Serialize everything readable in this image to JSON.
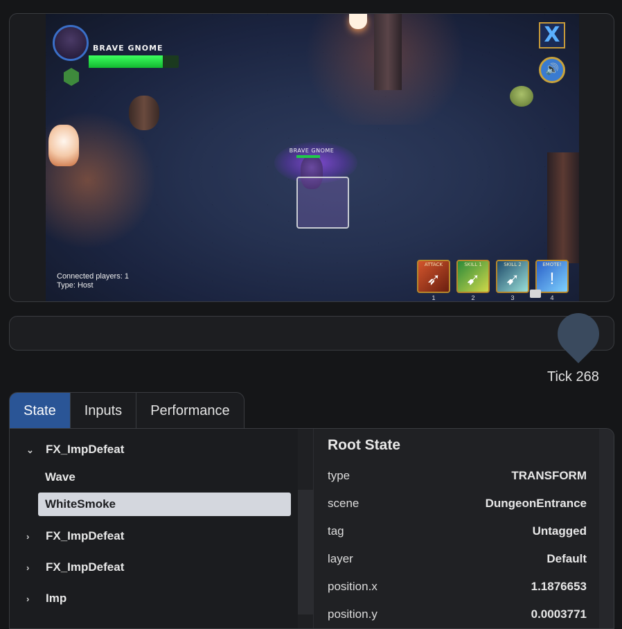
{
  "game": {
    "hud": {
      "player_name": "BRAVE GNOME",
      "health_fraction": 0.82,
      "overhead_name": "BRAVE GNOME"
    },
    "connection": {
      "players_line": "Connected players: 1",
      "type_line": "Type: Host"
    },
    "close_glyph": "X",
    "sound_glyph": "🔊",
    "abilities": [
      {
        "label": "ATTACK",
        "key": "1",
        "glyph": "➶",
        "icon": "bow-icon"
      },
      {
        "label": "SKILL 1",
        "key": "2",
        "glyph": "➹",
        "icon": "skill-arrow-icon"
      },
      {
        "label": "SKILL 2",
        "key": "3",
        "glyph": "➹",
        "icon": "multi-arrow-icon"
      },
      {
        "label": "EMOTE!",
        "key": "4",
        "glyph": "!",
        "icon": "emote-icon"
      }
    ]
  },
  "timeline": {
    "tick_label": "Tick 268"
  },
  "tabs": [
    {
      "label": "State",
      "active": true
    },
    {
      "label": "Inputs",
      "active": false
    },
    {
      "label": "Performance",
      "active": false
    }
  ],
  "tree": {
    "items": [
      {
        "label": "FX_ImpDefeat",
        "chevron": "⌄",
        "expanded": true
      },
      {
        "label": "Wave"
      },
      {
        "label": "WhiteSmoke",
        "selected": true
      },
      {
        "label": "FX_ImpDefeat",
        "chevron": "›"
      },
      {
        "label": "FX_ImpDefeat",
        "chevron": "›"
      },
      {
        "label": "Imp",
        "chevron": "›"
      }
    ]
  },
  "state": {
    "title": "Root State",
    "properties": [
      {
        "key": "type",
        "value": "TRANSFORM"
      },
      {
        "key": "scene",
        "value": "DungeonEntrance"
      },
      {
        "key": "tag",
        "value": "Untagged"
      },
      {
        "key": "layer",
        "value": "Default"
      },
      {
        "key": "position.x",
        "value": "1.1876653"
      },
      {
        "key": "position.y",
        "value": "0.0003771"
      }
    ]
  },
  "colors": {
    "accent_tab": "#2a5596",
    "health_green": "#20c94a",
    "selected_row": "#d4d7de"
  }
}
